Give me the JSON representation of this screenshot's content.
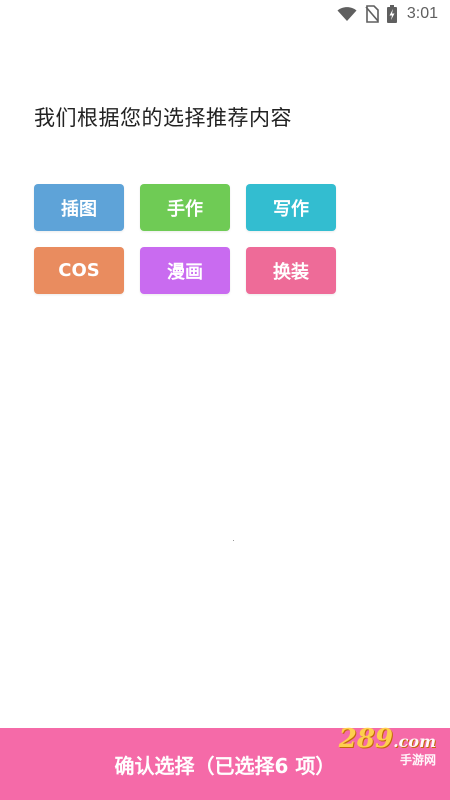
{
  "status_bar": {
    "time": "3:01",
    "icons": [
      "wifi-icon",
      "no-sim-icon",
      "battery-charging-icon"
    ]
  },
  "heading": "我们根据您的选择推荐内容",
  "tags": [
    {
      "label": "插图",
      "color": "#5ea3d8"
    },
    {
      "label": "手作",
      "color": "#6fcb55"
    },
    {
      "label": "写作",
      "color": "#33bdd0"
    },
    {
      "label": "COS",
      "color": "#e98c5f"
    },
    {
      "label": "漫画",
      "color": "#c96bf0"
    },
    {
      "label": "换装",
      "color": "#ee6b98"
    }
  ],
  "confirm_button": {
    "label": "确认选择（已选择6 项）",
    "color": "#f56aa8"
  },
  "watermark": {
    "logo": "289",
    "logo_suffix": ".com",
    "subtitle": "手游网"
  }
}
